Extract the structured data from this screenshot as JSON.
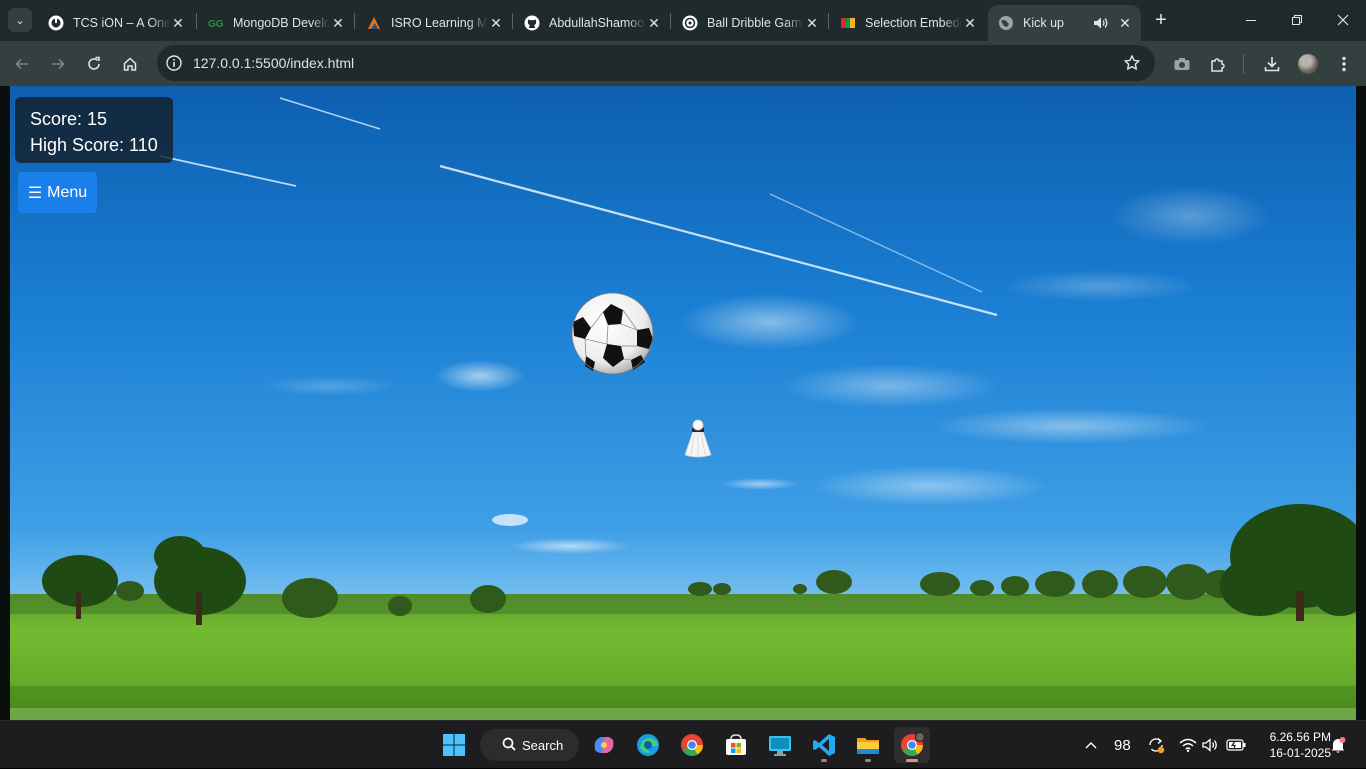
{
  "browser": {
    "tabs": [
      {
        "title": "TCS iON – A One",
        "active": false
      },
      {
        "title": "MongoDB Developer",
        "active": false
      },
      {
        "title": "ISRO Learning Management",
        "active": false
      },
      {
        "title": "AbdullahShamoon",
        "active": false
      },
      {
        "title": "Ball Dribble Game",
        "active": false
      },
      {
        "title": "Selection Embedded",
        "active": false
      },
      {
        "title": "Kick up",
        "active": true
      }
    ],
    "url": "127.0.0.1:5500/index.html"
  },
  "game": {
    "score_label": "Score: 15",
    "high_score_label": "High Score: 110",
    "menu_icon": "☰",
    "menu_label": "Menu"
  },
  "taskbar": {
    "search_label": "Search",
    "battery_percent": "98",
    "time": "6.26.56 PM",
    "date": "16-01-2025"
  },
  "colors": {
    "menu_button": "#1a7fe8",
    "score_panel": "#14202a",
    "tab_strip": "#1e2a2b",
    "toolbar": "#34403f"
  },
  "icons": [
    "tab-search-icon",
    "back-icon",
    "forward-icon",
    "reload-icon",
    "home-icon",
    "site-info-icon",
    "bookmark-star-icon",
    "camera-icon",
    "extensions-icon",
    "download-icon",
    "profile-avatar",
    "more-icon",
    "minimize-icon",
    "maximize-icon",
    "close-window-icon",
    "speaker-icon",
    "soccer-ball",
    "shuttlecock",
    "windows-start-icon",
    "copilot-icon",
    "edge-icon",
    "chrome-icon",
    "store-icon",
    "vscode-icon",
    "file-explorer-icon",
    "wifi-icon",
    "volume-icon",
    "battery-icon",
    "notification-bell-icon"
  ]
}
